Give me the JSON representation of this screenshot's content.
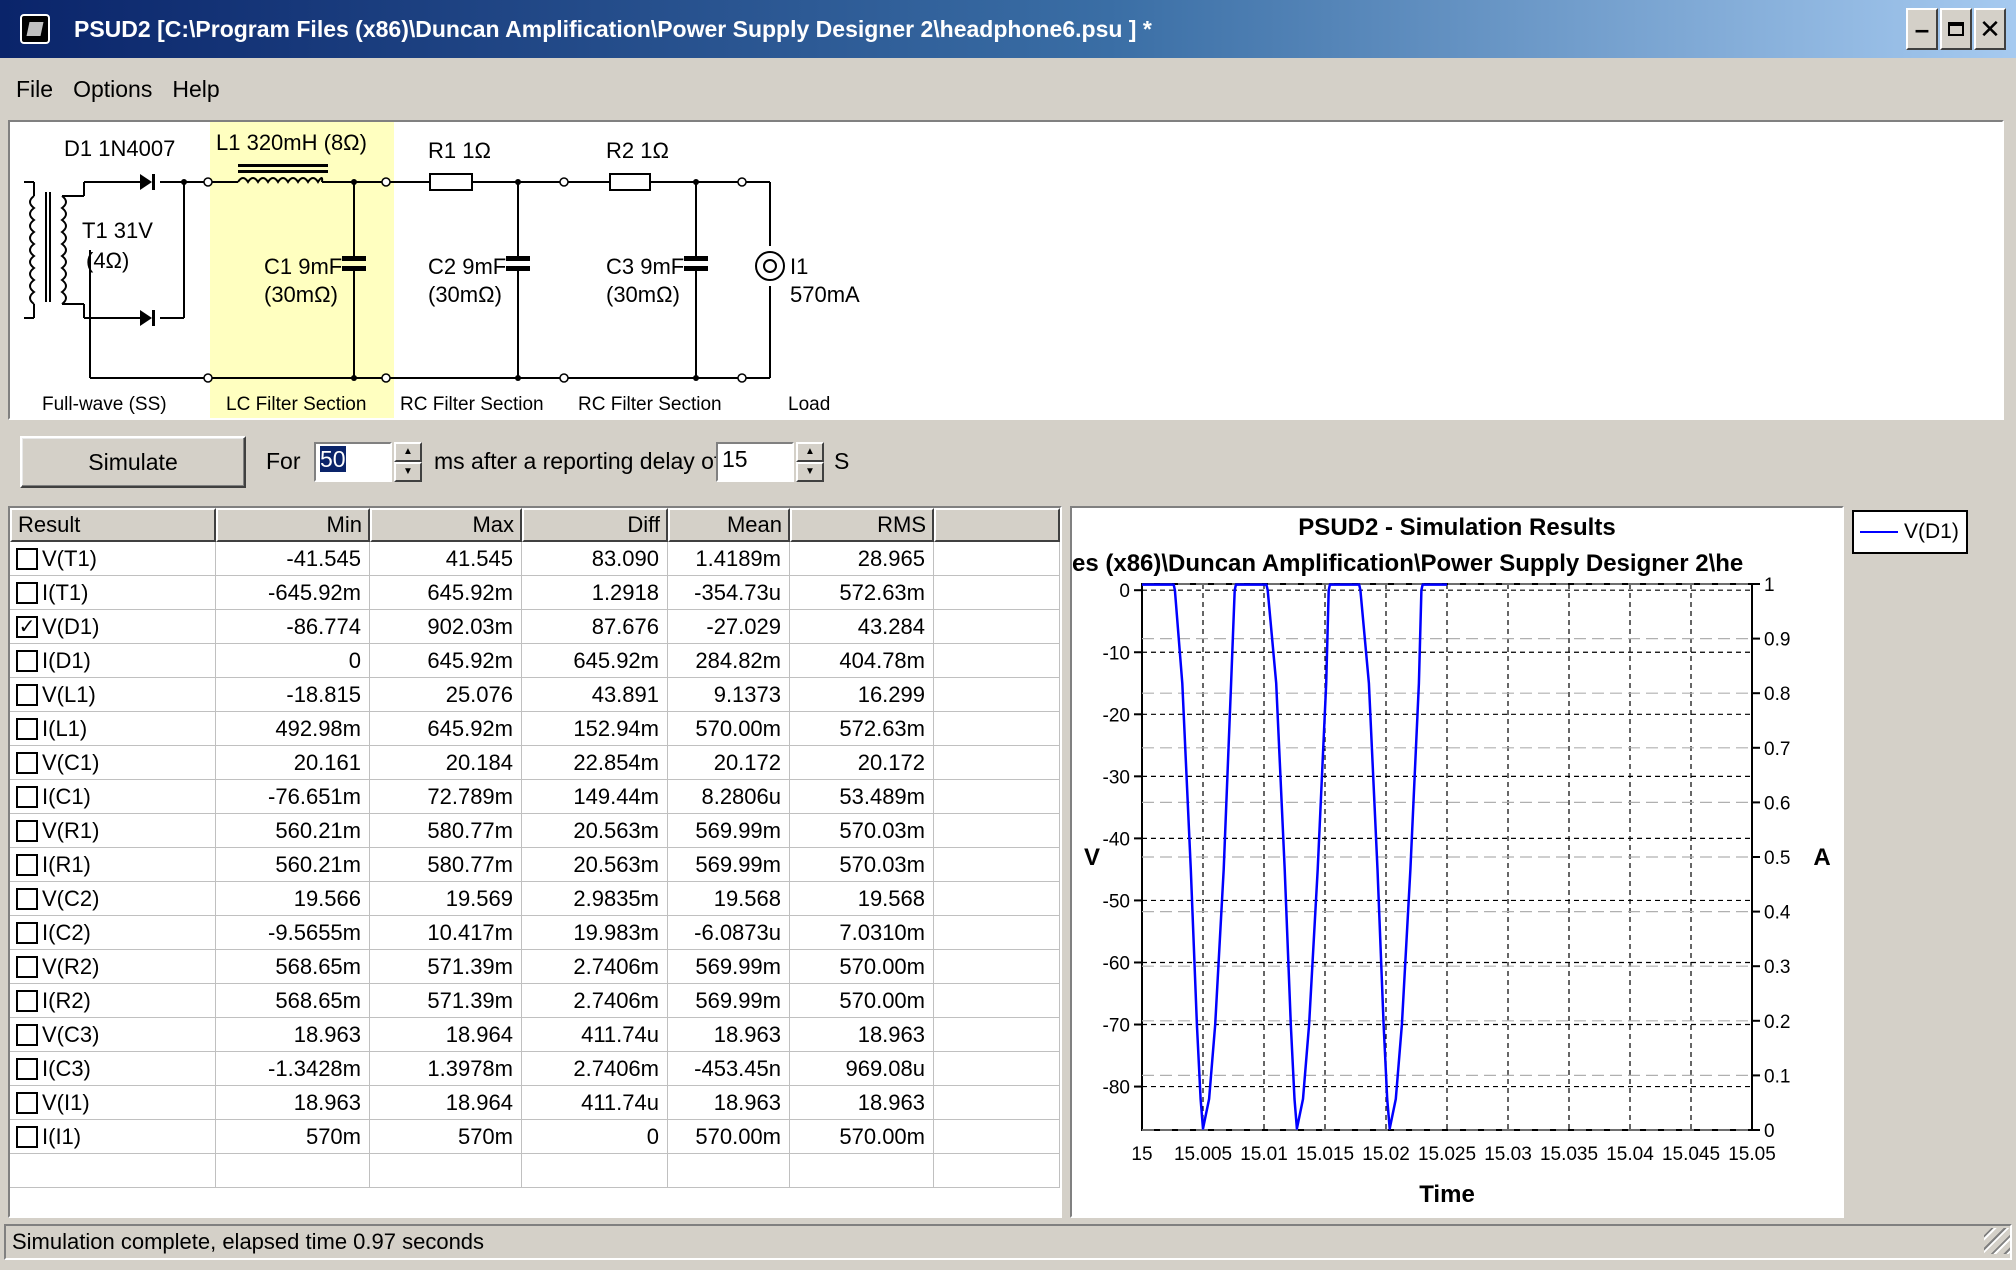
{
  "window": {
    "title": "PSUD2  [C:\\Program Files (x86)\\Duncan Amplification\\Power Supply Designer 2\\headphone6.psu ] *",
    "minimize_icon": "minimize-icon",
    "maximize_icon": "maximize-icon",
    "close_icon": "close-icon"
  },
  "menu": [
    "File",
    "Options",
    "Help"
  ],
  "schematic": {
    "d1": "D1 1N4007",
    "l1": "L1 320mH (8Ω)",
    "r1": "R1 1Ω",
    "r2": "R2 1Ω",
    "t1_line1": "T1 31V",
    "t1_line2": "(4Ω)",
    "c1_line1": "C1 9mF",
    "c1_line2": "(30mΩ)",
    "c2_line1": "C2 9mF",
    "c2_line2": "(30mΩ)",
    "c3_line1": "C3 9mF",
    "c3_line2": "(30mΩ)",
    "i1_line1": "I1",
    "i1_line2": "570mA",
    "sections": [
      "Full-wave (SS)",
      "LC Filter Section",
      "RC Filter Section",
      "RC Filter Section",
      "Load"
    ],
    "highlight_color": "#ffffc0"
  },
  "controls": {
    "simulate": "Simulate",
    "for_label": "For",
    "for_value": "50",
    "ms_label": "ms  after a reporting delay of",
    "delay_value": "15",
    "s_label": "S"
  },
  "table": {
    "headers": [
      "Result",
      "Min",
      "Max",
      "Diff",
      "Mean",
      "RMS"
    ],
    "rows": [
      {
        "name": "V(T1)",
        "checked": false,
        "min": "-41.545",
        "max": "41.545",
        "diff": "83.090",
        "mean": "1.4189m",
        "rms": "28.965"
      },
      {
        "name": "I(T1)",
        "checked": false,
        "min": "-645.92m",
        "max": "645.92m",
        "diff": "1.2918",
        "mean": "-354.73u",
        "rms": "572.63m"
      },
      {
        "name": "V(D1)",
        "checked": true,
        "min": "-86.774",
        "max": "902.03m",
        "diff": "87.676",
        "mean": "-27.029",
        "rms": "43.284"
      },
      {
        "name": "I(D1)",
        "checked": false,
        "min": "0",
        "max": "645.92m",
        "diff": "645.92m",
        "mean": "284.82m",
        "rms": "404.78m"
      },
      {
        "name": "V(L1)",
        "checked": false,
        "min": "-18.815",
        "max": "25.076",
        "diff": "43.891",
        "mean": "9.1373",
        "rms": "16.299"
      },
      {
        "name": "I(L1)",
        "checked": false,
        "min": "492.98m",
        "max": "645.92m",
        "diff": "152.94m",
        "mean": "570.00m",
        "rms": "572.63m"
      },
      {
        "name": "V(C1)",
        "checked": false,
        "min": "20.161",
        "max": "20.184",
        "diff": "22.854m",
        "mean": "20.172",
        "rms": "20.172"
      },
      {
        "name": "I(C1)",
        "checked": false,
        "min": "-76.651m",
        "max": "72.789m",
        "diff": "149.44m",
        "mean": "8.2806u",
        "rms": "53.489m"
      },
      {
        "name": "V(R1)",
        "checked": false,
        "min": "560.21m",
        "max": "580.77m",
        "diff": "20.563m",
        "mean": "569.99m",
        "rms": "570.03m"
      },
      {
        "name": "I(R1)",
        "checked": false,
        "min": "560.21m",
        "max": "580.77m",
        "diff": "20.563m",
        "mean": "569.99m",
        "rms": "570.03m"
      },
      {
        "name": "V(C2)",
        "checked": false,
        "min": "19.566",
        "max": "19.569",
        "diff": "2.9835m",
        "mean": "19.568",
        "rms": "19.568"
      },
      {
        "name": "I(C2)",
        "checked": false,
        "min": "-9.5655m",
        "max": "10.417m",
        "diff": "19.983m",
        "mean": "-6.0873u",
        "rms": "7.0310m"
      },
      {
        "name": "V(R2)",
        "checked": false,
        "min": "568.65m",
        "max": "571.39m",
        "diff": "2.7406m",
        "mean": "569.99m",
        "rms": "570.00m"
      },
      {
        "name": "I(R2)",
        "checked": false,
        "min": "568.65m",
        "max": "571.39m",
        "diff": "2.7406m",
        "mean": "569.99m",
        "rms": "570.00m"
      },
      {
        "name": "V(C3)",
        "checked": false,
        "min": "18.963",
        "max": "18.964",
        "diff": "411.74u",
        "mean": "18.963",
        "rms": "18.963"
      },
      {
        "name": "I(C3)",
        "checked": false,
        "min": "-1.3428m",
        "max": "1.3978m",
        "diff": "2.7406m",
        "mean": "-453.45n",
        "rms": "969.08u"
      },
      {
        "name": "V(I1)",
        "checked": false,
        "min": "18.963",
        "max": "18.964",
        "diff": "411.74u",
        "mean": "18.963",
        "rms": "18.963"
      },
      {
        "name": "I(I1)",
        "checked": false,
        "min": "570m",
        "max": "570m",
        "diff": "0",
        "mean": "570.00m",
        "rms": "570.00m"
      }
    ]
  },
  "chart_data": {
    "type": "line",
    "title": "PSUD2 - Simulation Results",
    "subtitle": "es (x86)\\Duncan Amplification\\Power Supply Designer 2\\he",
    "xlabel": "Time",
    "ylabel": "V",
    "y2label": "A",
    "xlim": [
      15,
      15.05
    ],
    "ylim": [
      -87,
      1
    ],
    "y2lim": [
      0,
      1
    ],
    "x_ticks": [
      "15",
      "15.005",
      "15.01",
      "15.015",
      "15.02",
      "15.025",
      "15.03",
      "15.035",
      "15.04",
      "15.045",
      "15.05"
    ],
    "y_ticks": [
      0,
      -10,
      -20,
      -30,
      -40,
      -50,
      -60,
      -70,
      -80
    ],
    "y2_ticks": [
      "1",
      "0.9",
      "0.8",
      "0.7",
      "0.6",
      "0.5",
      "0.4",
      "0.3",
      "0.2",
      "0.1",
      "0"
    ],
    "grid": true,
    "legend_position": "top-right",
    "series": [
      {
        "name": "V(D1)",
        "color": "#0000ff",
        "x": [
          15.0,
          15.0026,
          15.0027,
          15.0033,
          15.004,
          15.0045,
          15.0048,
          15.005,
          15.0055,
          15.006,
          15.0067,
          15.0073,
          15.0076,
          15.0077,
          15.0102,
          15.0103,
          15.011,
          15.0117,
          15.0122,
          15.0125,
          15.0127,
          15.0132,
          15.0137,
          15.0144,
          15.0151,
          15.0153,
          15.0154,
          15.0178,
          15.0179,
          15.0186,
          15.0193,
          15.0198,
          15.0201,
          15.0203,
          15.0208,
          15.0213,
          15.022,
          15.0227,
          15.0229,
          15.023,
          15.025
        ],
        "values": [
          0.9,
          0.9,
          0,
          -15,
          -45,
          -70,
          -82,
          -86.774,
          -82,
          -70,
          -45,
          -15,
          0,
          0.9,
          0.9,
          0,
          -15,
          -45,
          -70,
          -82,
          -86.774,
          -82,
          -70,
          -45,
          -15,
          0,
          0.9,
          0.9,
          0,
          -15,
          -45,
          -70,
          -82,
          -86.774,
          -82,
          -70,
          -45,
          -15,
          0,
          0.9,
          0.9
        ]
      }
    ]
  },
  "status": "Simulation complete, elapsed time 0.97 seconds"
}
